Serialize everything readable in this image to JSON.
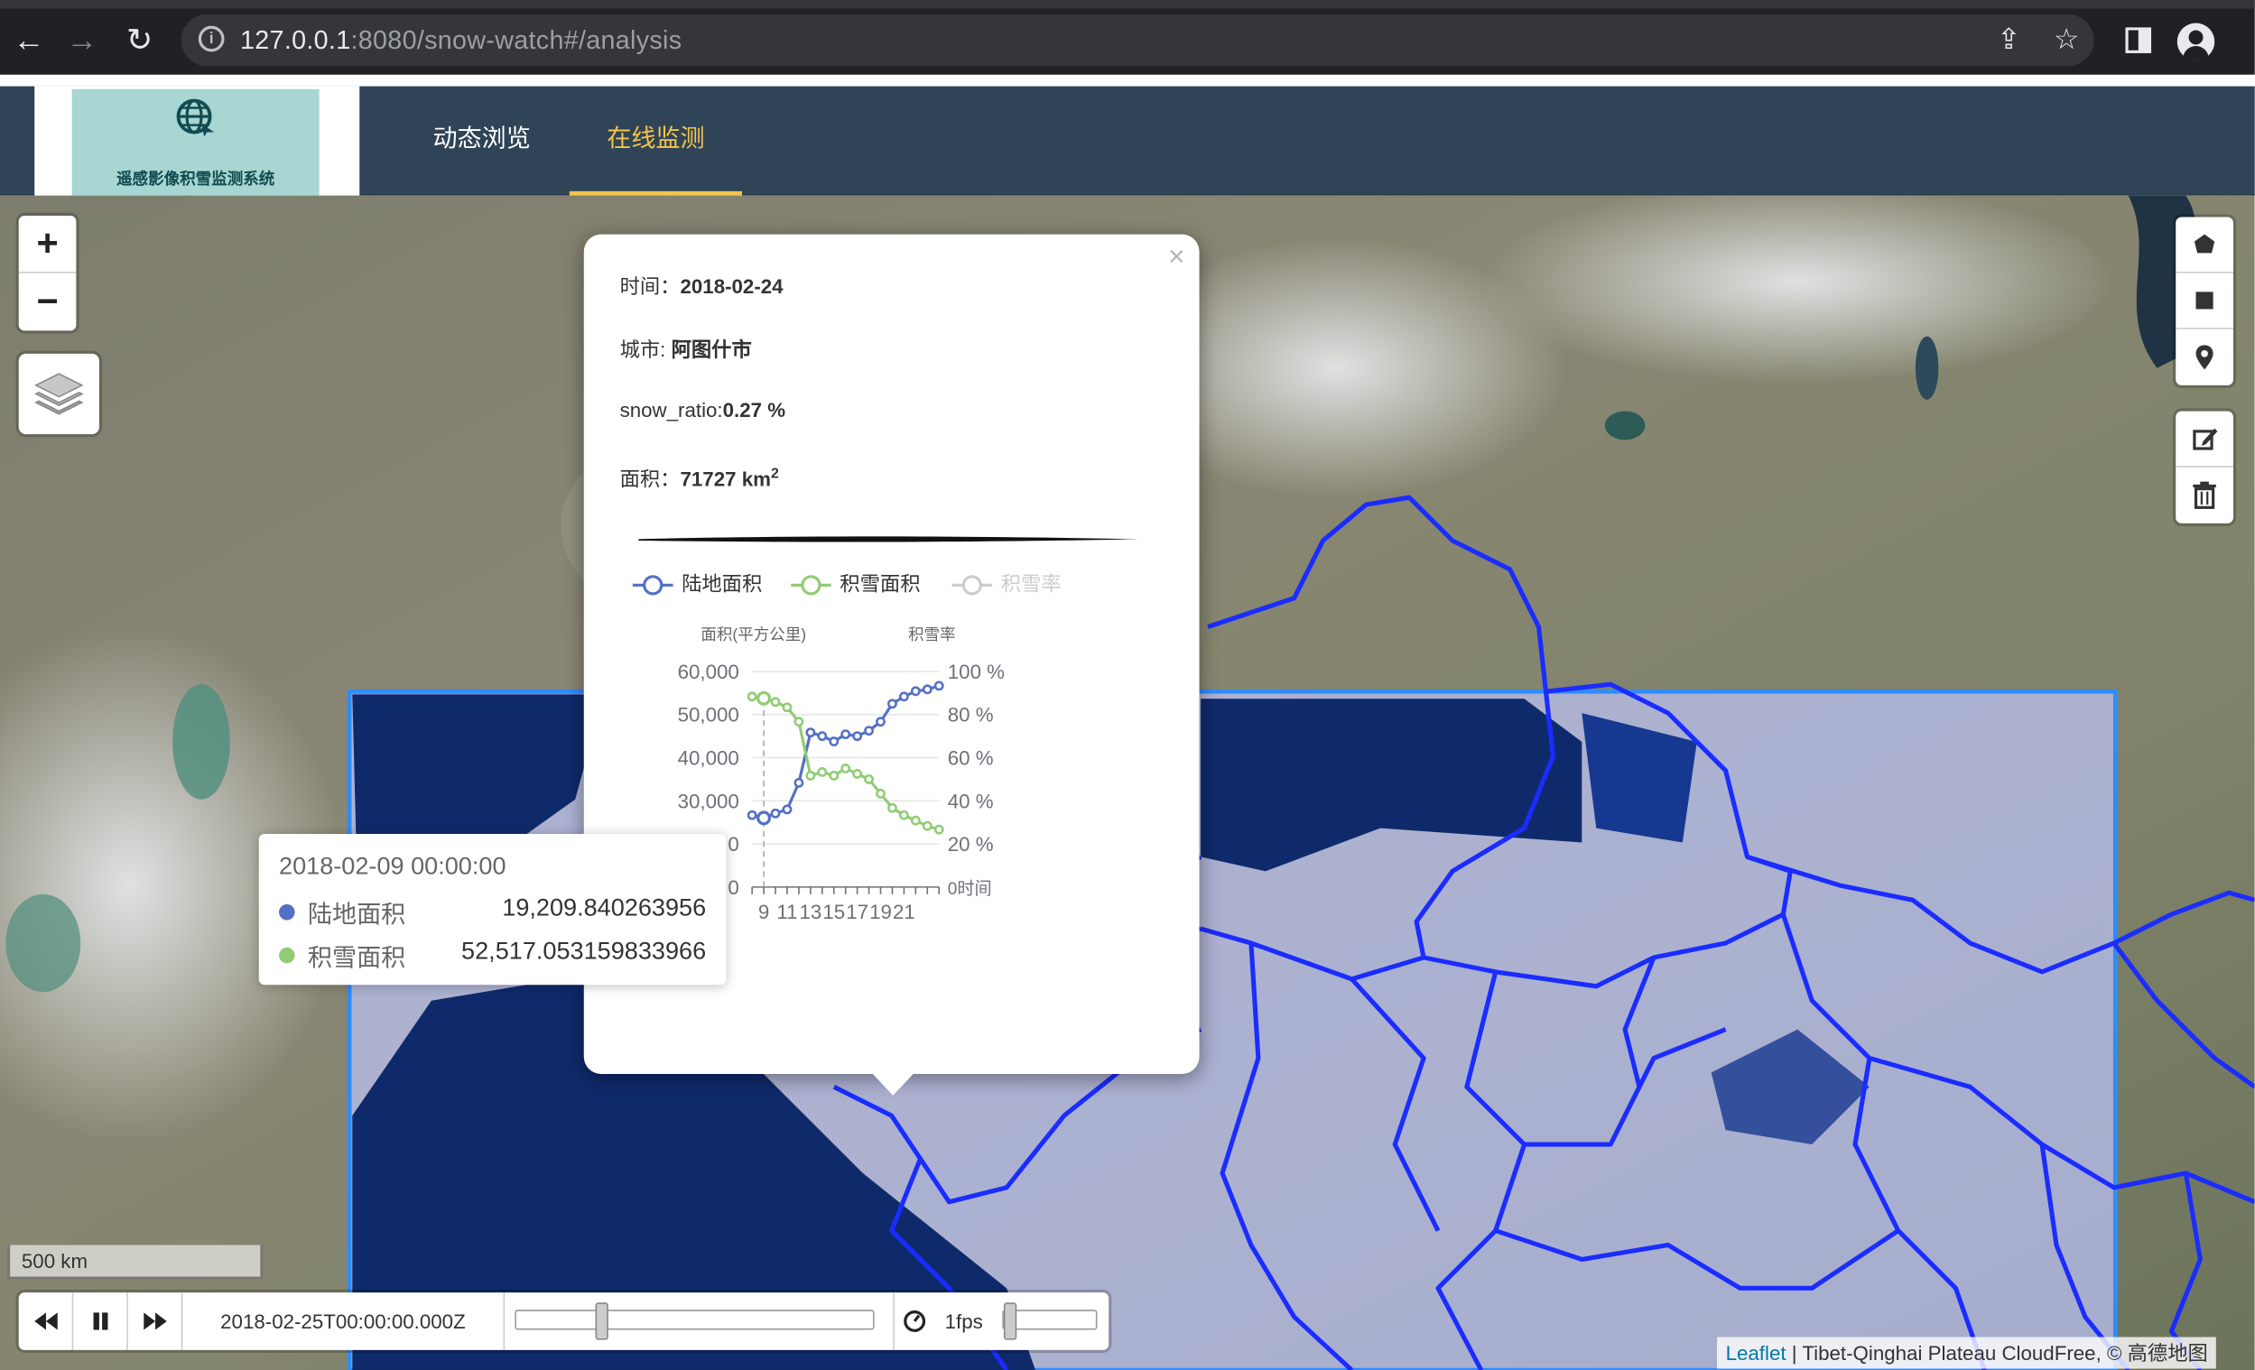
{
  "browser": {
    "url_host": "127.0.0.1",
    "url_rest": ":8080/snow-watch#/analysis"
  },
  "header": {
    "logo_title": "遥感影像积雪监测系统",
    "tabs": [
      {
        "label": "动态浏览",
        "active": false
      },
      {
        "label": "在线监测",
        "active": true
      }
    ]
  },
  "colors": {
    "header_bg": "#304457",
    "active_tab": "#f3c44b",
    "land_series": "#5470c6",
    "snow_series": "#91cc75",
    "region_outline": "#1a2cff"
  },
  "popup": {
    "time_label": "时间：",
    "time_value": "2018-02-24",
    "city_label": "城市: ",
    "city_value": "阿图什市",
    "ratio_label": "snow_ratio:",
    "ratio_value": "0.27 %",
    "area_label": "面积：",
    "area_value": "71727 km",
    "area_sup": "2",
    "close": "×"
  },
  "chart_data": {
    "type": "line",
    "legend": [
      "陆地面积",
      "积雪面积",
      "积雪率"
    ],
    "legend_disabled": [
      "积雪率"
    ],
    "y_left_name": "面积(平方公里)",
    "y_right_name": "积雪率",
    "y_left_ticks": [
      "60,000",
      "50,000",
      "40,000",
      "30,000",
      "0",
      "0"
    ],
    "y_right_ticks": [
      "100 %",
      "80 %",
      "60 %",
      "40 %",
      "20 %",
      "0时间"
    ],
    "x_tick_labels": [
      "9",
      "11",
      "13",
      "15",
      "17",
      "19",
      "21"
    ],
    "x": [
      8,
      9,
      10,
      11,
      12,
      13,
      14,
      15,
      16,
      17,
      18,
      19,
      20,
      21,
      22,
      23,
      24
    ],
    "ylim": [
      0,
      60000
    ],
    "series": [
      {
        "name": "陆地面积",
        "values": [
          20000,
          19210,
          20500,
          21600,
          29000,
          43000,
          42000,
          40500,
          42500,
          42000,
          43500,
          46000,
          51000,
          53000,
          54500,
          55000,
          56000
        ]
      },
      {
        "name": "积雪面积",
        "values": [
          53000,
          52517,
          51500,
          50000,
          46000,
          31000,
          32000,
          31000,
          33000,
          31500,
          30000,
          26000,
          22000,
          20000,
          18500,
          17000,
          16000
        ]
      }
    ],
    "hover_index": 1
  },
  "tooltip": {
    "time": "2018-02-09 00:00:00",
    "rows": [
      {
        "label": "陆地面积",
        "value": "19,209.840263956"
      },
      {
        "label": "积雪面积",
        "value": "52,517.053159833966"
      }
    ]
  },
  "map": {
    "scale_label": "500 km",
    "zoom_in": "+",
    "zoom_out": "−",
    "timeline_date": "2018-02-25T00:00:00.000Z",
    "timeline_progress": 0.24,
    "fps_label": "1fps",
    "attribution_link": "Leaflet",
    "attribution_text": " | Tibet-Qinghai Plateau CloudFree, © 高德地图"
  }
}
